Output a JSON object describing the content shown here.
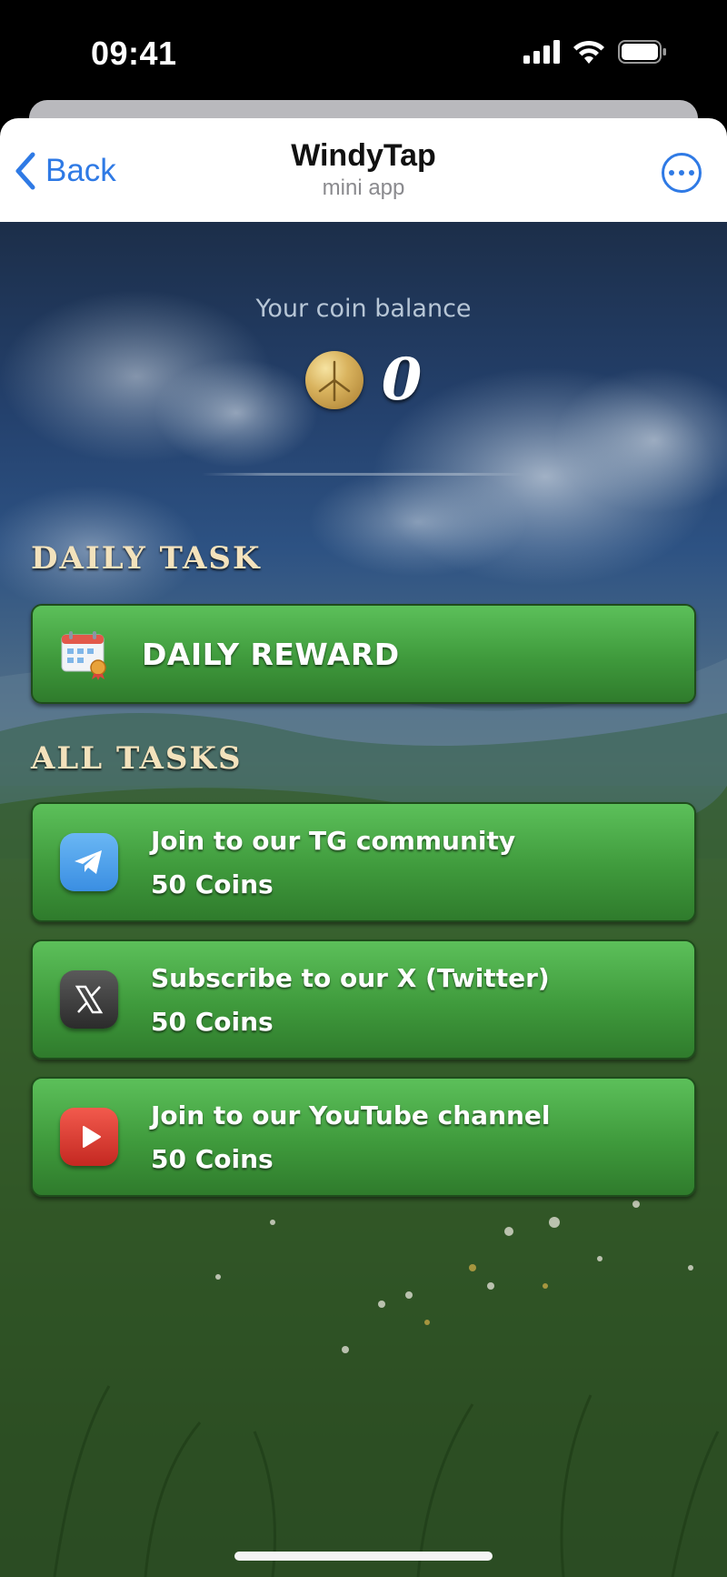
{
  "status_bar": {
    "time": "09:41"
  },
  "header": {
    "back_label": "Back",
    "title": "WindyTap",
    "subtitle": "mini app"
  },
  "balance": {
    "label": "Your coin balance",
    "value": "0"
  },
  "daily_section": {
    "title": "DAILY TASK",
    "button_label": "DAILY REWARD"
  },
  "all_tasks": {
    "title": "ALL TASKS",
    "items": [
      {
        "icon": "telegram-icon",
        "title": "Join to our TG community",
        "reward": "50 Coins"
      },
      {
        "icon": "x-twitter-icon",
        "title": "Subscribe to our X (Twitter)",
        "reward": "50 Coins"
      },
      {
        "icon": "youtube-icon",
        "title": "Join to our YouTube channel",
        "reward": "50 Coins"
      }
    ]
  },
  "colors": {
    "ios_blue": "#2f7ae5",
    "task_green": "#4caf50",
    "section_title": "#f3e2bc"
  }
}
